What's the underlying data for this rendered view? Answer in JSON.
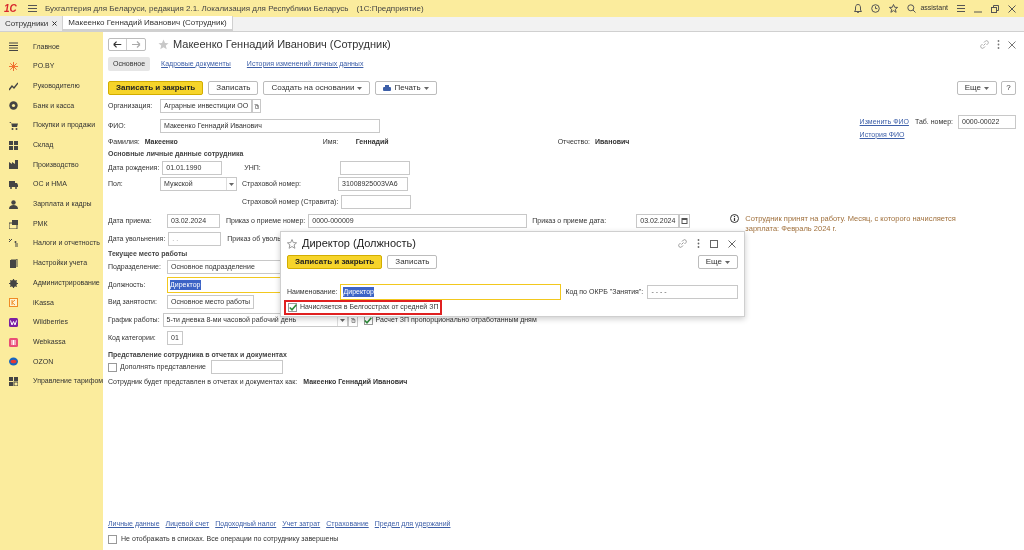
{
  "window": {
    "logo": "1С",
    "title": "Бухгалтерия для Беларуси, редакция 2.1. Локализация для Республики Беларусь",
    "app": "(1С:Предприятие)",
    "user": "assistant"
  },
  "open_tabs": [
    {
      "label": "Сотрудники",
      "selected": false
    },
    {
      "label": "Макеенко Геннадий Иванович (Сотрудник)",
      "selected": true
    }
  ],
  "sidebar": {
    "items": [
      {
        "label": "Главное"
      },
      {
        "label": "PO.BY"
      },
      {
        "label": "Руководителю"
      },
      {
        "label": "Банк и касса"
      },
      {
        "label": "Покупки и продажи"
      },
      {
        "label": "Склад"
      },
      {
        "label": "Производство"
      },
      {
        "label": "ОС и НМА"
      },
      {
        "label": "Зарплата и кадры"
      },
      {
        "label": "РМК"
      },
      {
        "label": "Налоги и отчетность"
      },
      {
        "label": "Настройки учета"
      },
      {
        "label": "Администрирование"
      },
      {
        "label": "iKassa"
      },
      {
        "label": "Wildberries"
      },
      {
        "label": "Webkassa"
      },
      {
        "label": "OZON"
      },
      {
        "label": "Управление тарифом"
      }
    ]
  },
  "form": {
    "title": "Макеенко Геннадий Иванович (Сотрудник)",
    "tabs": [
      {
        "label": "Основное",
        "selected": true
      },
      {
        "label": "Кадровые документы",
        "selected": false
      },
      {
        "label": "История изменений личных данных",
        "selected": false
      }
    ],
    "toolbar": [
      {
        "label": "Записать и закрыть",
        "kind": "primary"
      },
      {
        "label": "Записать",
        "kind": "plain"
      },
      {
        "label": "Создать на основании",
        "kind": "menu"
      },
      {
        "label": "Печать",
        "kind": "print"
      }
    ],
    "more": "Еще",
    "help": "?",
    "organization": {
      "label": "Организация:",
      "value": "Аграрные инвестиции ОО"
    },
    "fio": {
      "label": "ФИО:",
      "value": "Макеенко Геннадий Иванович"
    },
    "change_fio": "Изменить ФИО",
    "fio_history": "История ФИО",
    "tab_number": {
      "label": "Таб. номер:",
      "value": "0000-00022"
    },
    "surname": {
      "label": "Фамилия:",
      "value": "Макеенко"
    },
    "name": {
      "label": "Имя:",
      "value": "Геннадий"
    },
    "patronymic": {
      "label": "Отчество:",
      "value": "Иванович"
    },
    "personal_heading": "Основные личные данные сотрудника",
    "birth_date": {
      "label": "Дата рождения:",
      "value": "01.01.1990"
    },
    "unp": {
      "label": "УНП:"
    },
    "gender": {
      "label": "Пол:",
      "value": "Мужской"
    },
    "insurance_number": {
      "label": "Страховой номер:",
      "value": "31008925003VA6"
    },
    "insurance_stravita": {
      "label": "Страховой номер (Стравита):"
    },
    "hire_date": {
      "label": "Дата приема:",
      "value": "03.02.2024"
    },
    "hire_order_number": {
      "label": "Приказ о приеме номер:",
      "value": "0000-000009"
    },
    "hire_order_date": {
      "label": "Приказ о приеме дата:",
      "value": "03.02.2024"
    },
    "hire_note": "Сотрудник принят на работу. Месяц, с которого начисляется зарплата: Февраль 2024 г.",
    "dismissal_date": {
      "label": "Дата увольнения:",
      "placeholder": ". ."
    },
    "dismissal_order": {
      "label": "Приказ об уволь"
    },
    "workplace_heading": "Текущее место работы",
    "department": {
      "label": "Подразделение:",
      "value": "Основное подразделение"
    },
    "position": {
      "label": "Должность:",
      "value": "Директор"
    },
    "employment_type": {
      "label": "Вид занятости:",
      "value": "Основное место работы"
    },
    "schedule": {
      "label": "График работы:",
      "value": "5-ти дневка 8-ми часовой рабочий день"
    },
    "proportional": {
      "label": "Расчет ЗП пропорционально отработанным дням",
      "checked": true
    },
    "category_code": {
      "label": "Код категории:",
      "value": "01"
    },
    "representation_heading": "Представление сотрудника в отчетах и документах",
    "supplement": {
      "label": "Дополнять представление",
      "checked": false
    },
    "representation": {
      "label": "Сотрудник будет представлен в отчетах и документах как:",
      "value": "Макеенко Геннадий Иванович"
    },
    "footer_links": [
      "Личные данные",
      "Лицевой счет",
      "Подоходный налог",
      "Учет затрат",
      "Страхование",
      "Предел для удержаний"
    ],
    "hide_in_lists": {
      "label": "Не отображать в списках. Все операции по сотруднику завершены",
      "checked": false
    }
  },
  "dialog": {
    "title": "Директор (Должность)",
    "buttons": [
      {
        "label": "Записать и закрыть",
        "kind": "primary"
      },
      {
        "label": "Записать",
        "kind": "plain"
      }
    ],
    "more": "Еще",
    "name": {
      "label": "Наименование:",
      "value": "Директор"
    },
    "okrb": {
      "label": "Код по ОКРБ \"Занятия\":",
      "value": "-  -  - -"
    },
    "belgosstrakh": {
      "label": "Начисляется в Белгосстрах от средней ЗП",
      "checked": true,
      "highlighted": true
    }
  }
}
